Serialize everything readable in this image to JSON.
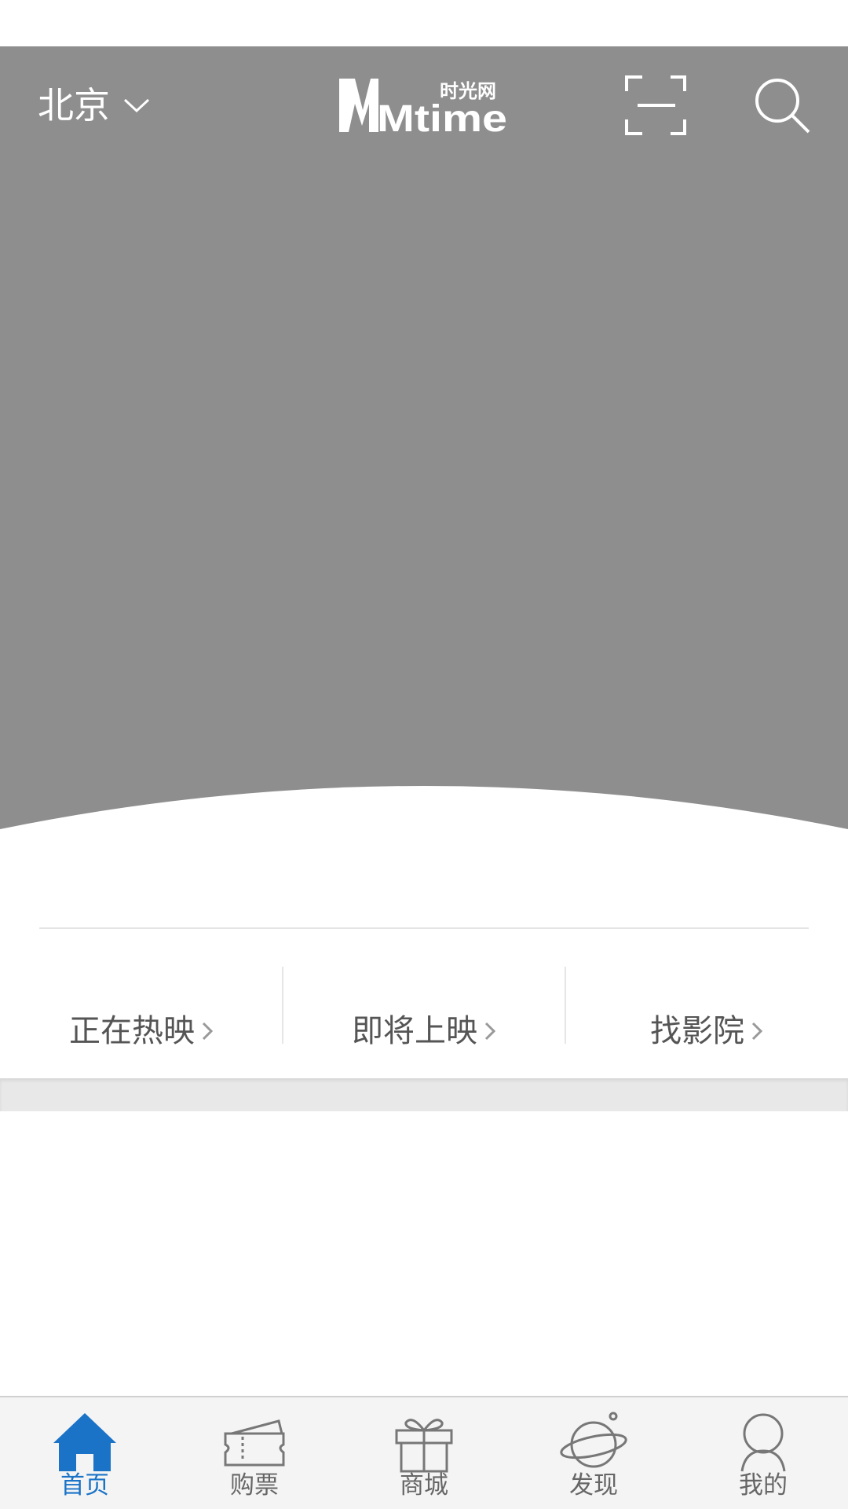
{
  "header": {
    "city": "北京",
    "logo": {
      "brand": "Mtime",
      "subtitle": "时光网"
    }
  },
  "quick_links": [
    {
      "label": "正在热映"
    },
    {
      "label": "即将上映"
    },
    {
      "label": "找影院"
    }
  ],
  "bottom_nav": [
    {
      "label": "首页",
      "icon": "home-icon",
      "active": true
    },
    {
      "label": "购票",
      "icon": "ticket-icon",
      "active": false
    },
    {
      "label": "商城",
      "icon": "gift-icon",
      "active": false
    },
    {
      "label": "发现",
      "icon": "planet-icon",
      "active": false
    },
    {
      "label": "我的",
      "icon": "user-icon",
      "active": false
    }
  ],
  "colors": {
    "banner": "#8e8e8e",
    "accent": "#1a73c7",
    "nav_bg": "#f4f4f4",
    "text_gray": "#555555"
  }
}
